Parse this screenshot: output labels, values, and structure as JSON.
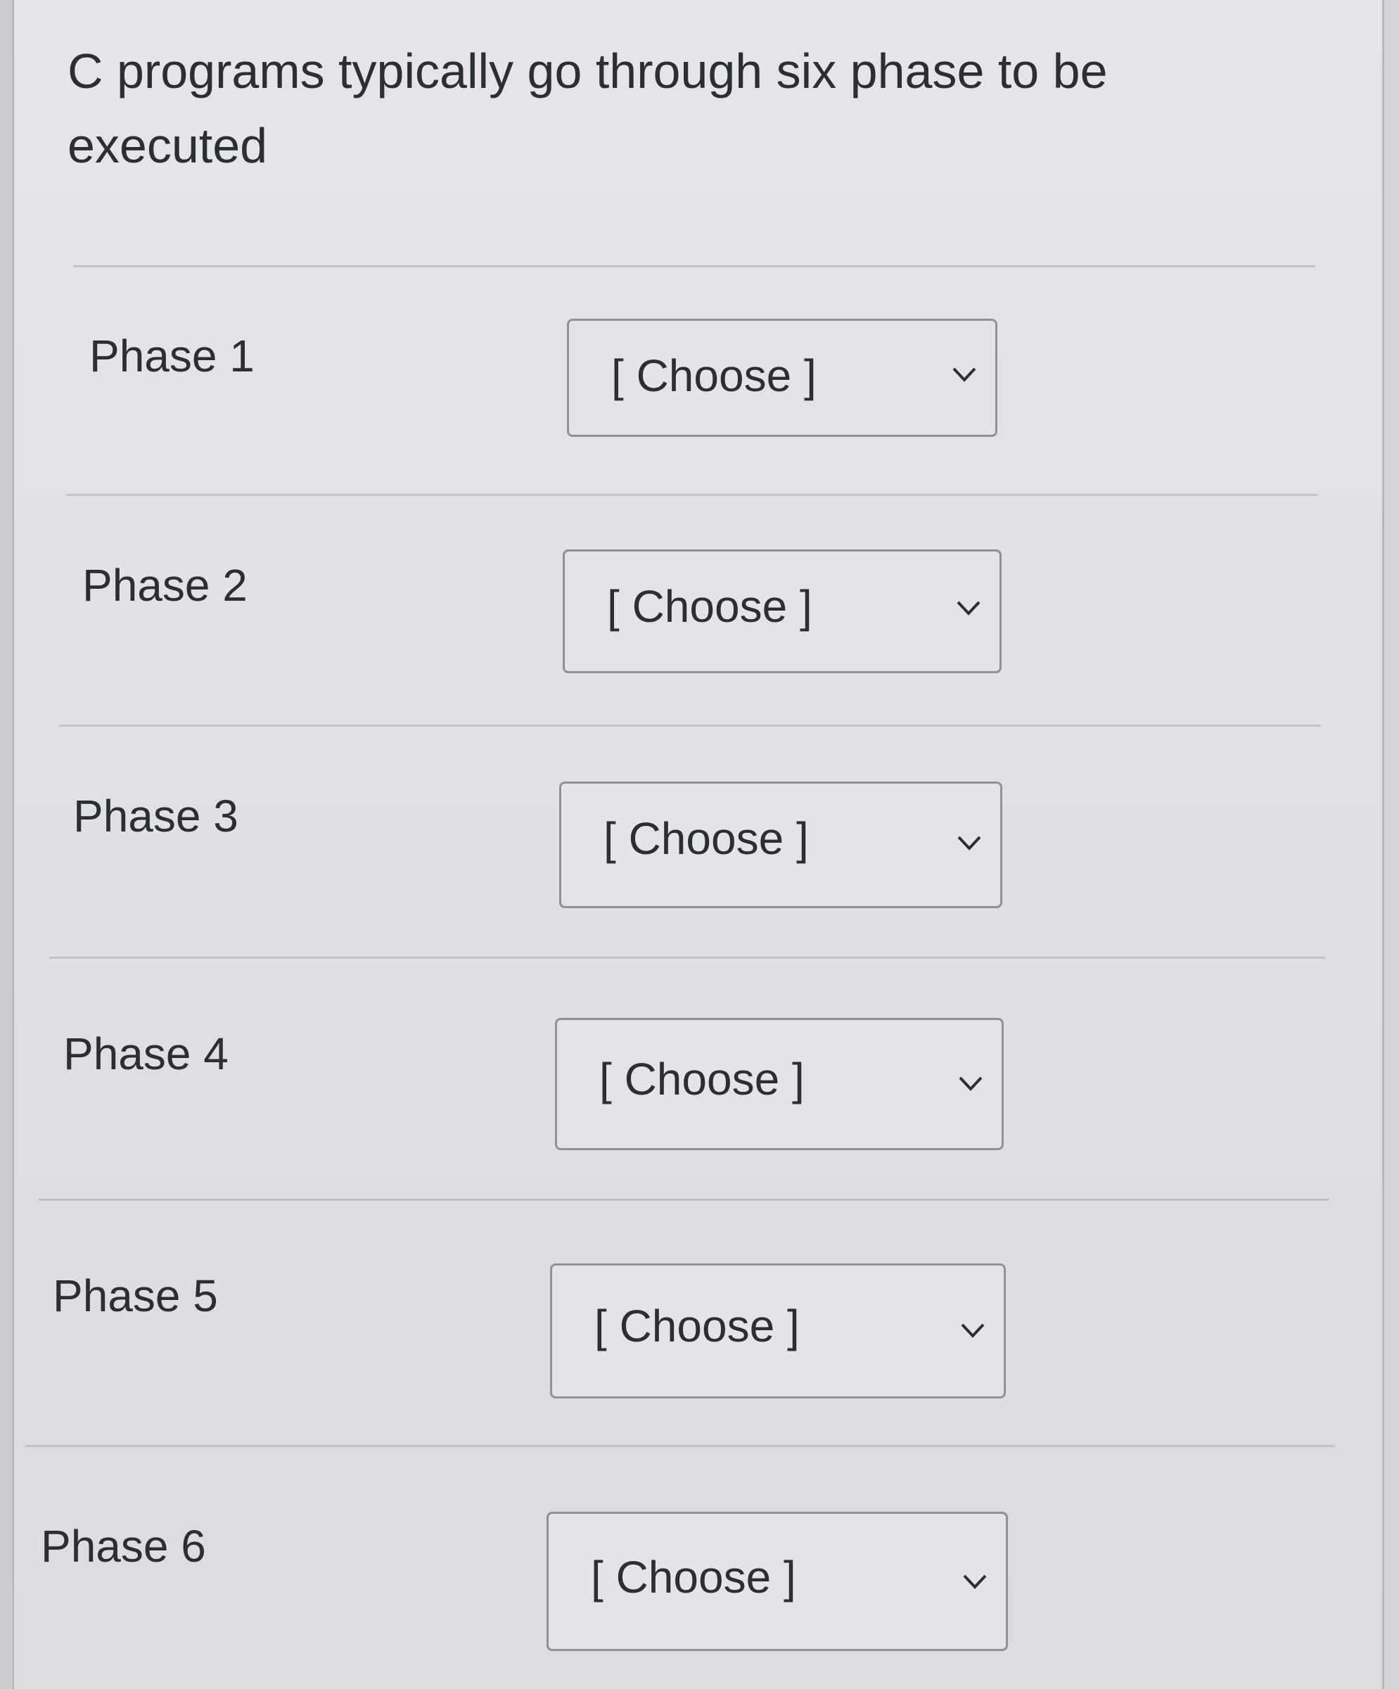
{
  "question": {
    "text": "C programs typically go through six phase to be executed"
  },
  "phases": [
    {
      "label": "Phase 1",
      "selected": "[ Choose ]"
    },
    {
      "label": "Phase 2",
      "selected": "[ Choose ]"
    },
    {
      "label": "Phase 3",
      "selected": "[ Choose ]"
    },
    {
      "label": "Phase 4",
      "selected": "[ Choose ]"
    },
    {
      "label": "Phase 5",
      "selected": "[ Choose ]"
    },
    {
      "label": "Phase 6",
      "selected": "[ Choose ]"
    }
  ],
  "icons": {
    "dropdown": "chevron-down-icon"
  },
  "colors": {
    "background": "#e3e2e7",
    "text": "#2b2f33",
    "select_border": "#8e9196",
    "divider": "#c3c2c8"
  }
}
